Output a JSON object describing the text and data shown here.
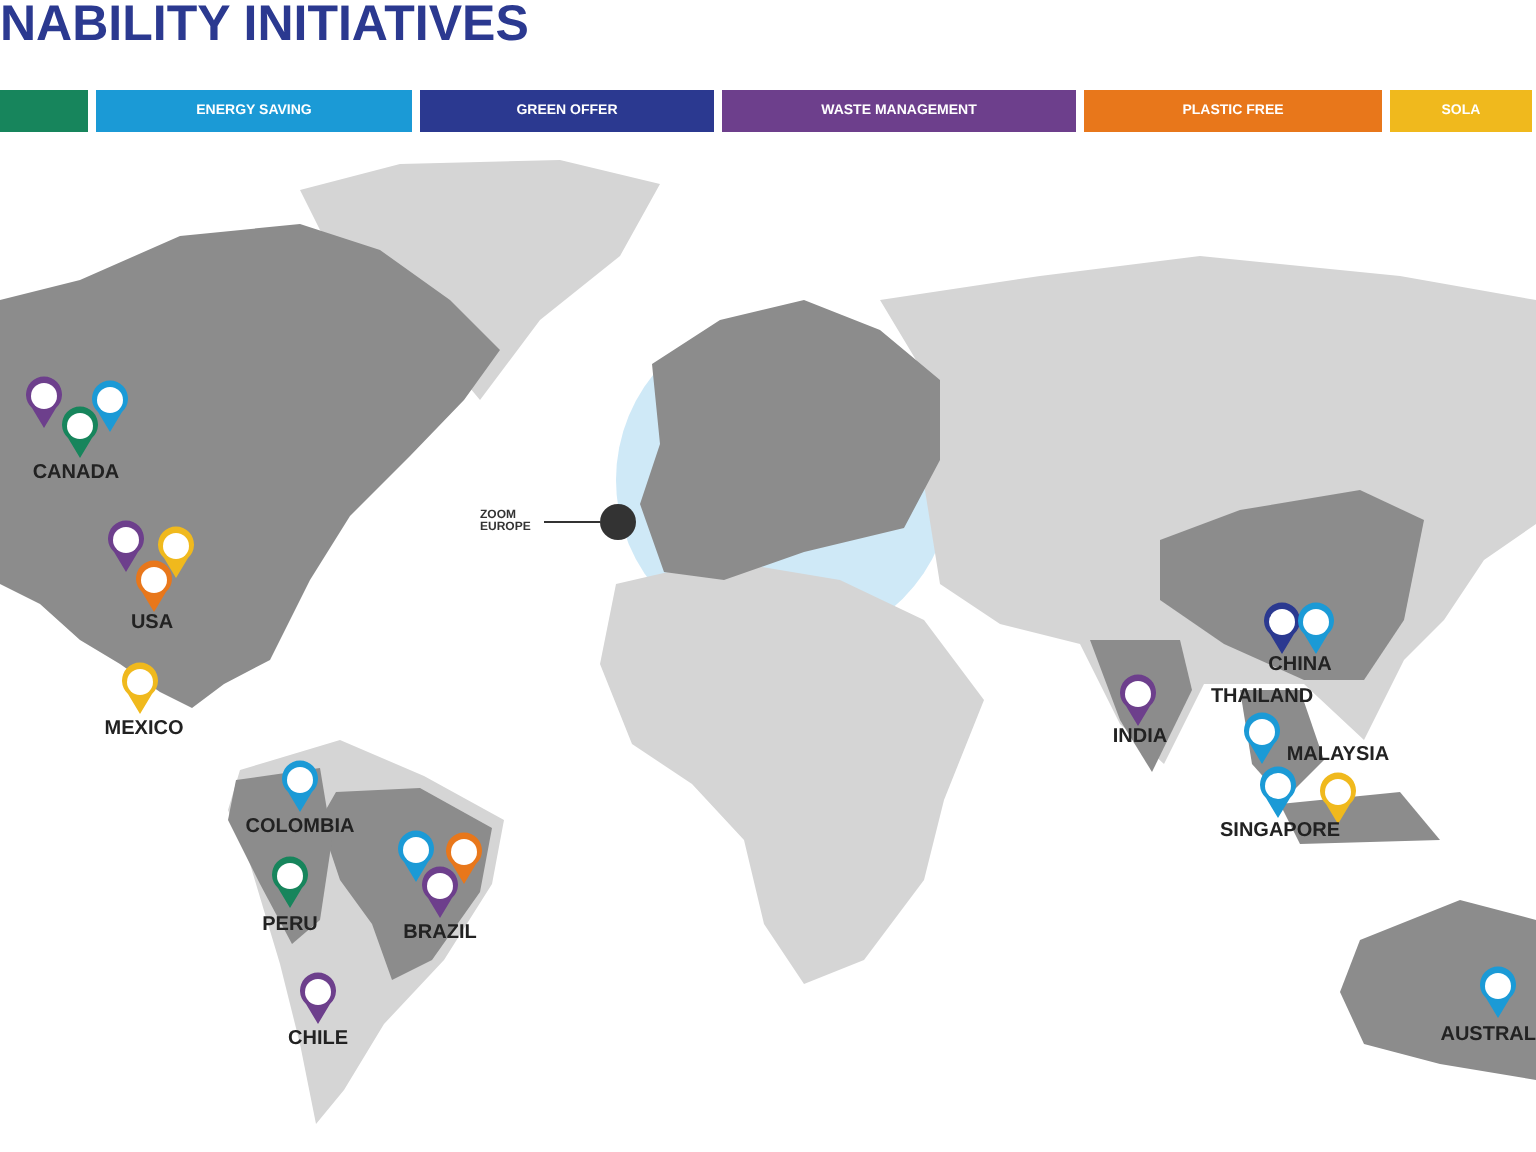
{
  "title": "NABILITY INITIATIVES",
  "legend": [
    {
      "color": "#17855c"
    },
    {
      "label": "ENERGY SAVING",
      "color": "#1b9ad6"
    },
    {
      "label": "GREEN OFFER",
      "color": "#2b3990"
    },
    {
      "label": "WASTE MANAGEMENT",
      "color": "#6d3f8c"
    },
    {
      "label": "PLASTIC FREE",
      "color": "#e8771b"
    },
    {
      "label": "SOLA",
      "color": "#f0b91d"
    }
  ],
  "zoom_callout": {
    "label": "ZOOM EUROPE"
  },
  "countries": [
    {
      "name": "CANADA",
      "pins": [
        {
          "color": "#6d3f8c"
        },
        {
          "color": "#1b9ad6"
        },
        {
          "color": "#17855c"
        }
      ]
    },
    {
      "name": "USA",
      "pins": [
        {
          "color": "#6d3f8c"
        },
        {
          "color": "#f0b91d"
        },
        {
          "color": "#e8771b"
        }
      ]
    },
    {
      "name": "MEXICO",
      "pins": [
        {
          "color": "#f0b91d"
        }
      ]
    },
    {
      "name": "COLOMBIA",
      "pins": [
        {
          "color": "#1b9ad6"
        }
      ]
    },
    {
      "name": "PERU",
      "pins": [
        {
          "color": "#17855c"
        }
      ]
    },
    {
      "name": "BRAZIL",
      "pins": [
        {
          "color": "#1b9ad6"
        },
        {
          "color": "#e8771b"
        },
        {
          "color": "#6d3f8c"
        }
      ]
    },
    {
      "name": "CHILE",
      "pins": [
        {
          "color": "#6d3f8c"
        }
      ]
    },
    {
      "name": "INDIA",
      "pins": [
        {
          "color": "#6d3f8c"
        }
      ]
    },
    {
      "name": "CHINA",
      "pins": [
        {
          "color": "#2b3990"
        },
        {
          "color": "#1b9ad6"
        }
      ]
    },
    {
      "name": "THAILAND",
      "pins": [
        {
          "color": "#1b9ad6"
        }
      ]
    },
    {
      "name": "MALAYSIA",
      "pins": [
        {
          "color": "#f0b91d"
        }
      ]
    },
    {
      "name": "SINGAPORE",
      "pins": [
        {
          "color": "#1b9ad6"
        }
      ]
    },
    {
      "name": "AUSTRAL",
      "pins": [
        {
          "color": "#1b9ad6"
        }
      ]
    }
  ]
}
